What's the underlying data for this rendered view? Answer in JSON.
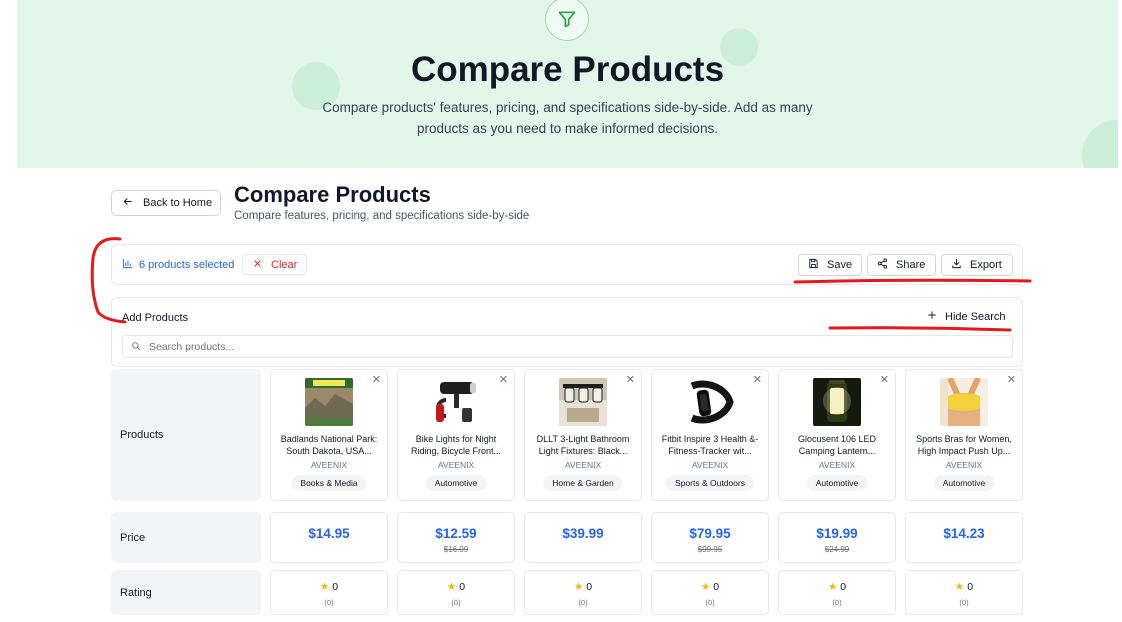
{
  "hero": {
    "title": "Compare Products",
    "subtitle": "Compare products' features, pricing, and specifications side-by-side. Add as many products as you need to make informed decisions.",
    "icon": "filter-icon"
  },
  "header": {
    "back_label": "Back to Home",
    "title": "Compare Products",
    "subtitle": "Compare features, pricing, and specifications side-by-side"
  },
  "toolbar": {
    "selected_text": "6 products selected",
    "clear_label": "Clear",
    "save_label": "Save",
    "share_label": "Share",
    "export_label": "Export"
  },
  "add_products": {
    "title": "Add Products",
    "hide_search_label": "Hide Search",
    "search_placeholder": "Search products..."
  },
  "rows": {
    "products": "Products",
    "price": "Price",
    "rating": "Rating"
  },
  "products": [
    {
      "name": "Badlands National Park: South Dakota, USA...",
      "brand": "AVEENIX",
      "category": "Books & Media",
      "price": "$14.95",
      "original_price": "",
      "rating": "0",
      "reviews": "(0)"
    },
    {
      "name": "Bike Lights for Night Riding, Bicycle Front...",
      "brand": "AVEENIX",
      "category": "Automotive",
      "price": "$12.59",
      "original_price": "$16.99",
      "rating": "0",
      "reviews": "(0)"
    },
    {
      "name": "DLLT 3-Light Bathroom Light Fixtures: Black...",
      "brand": "AVEENIX",
      "category": "Home & Garden",
      "price": "$39.99",
      "original_price": "",
      "rating": "0",
      "reviews": "(0)"
    },
    {
      "name": "Fitbit Inspire 3 Health &-Fitness-Tracker wit...",
      "brand": "AVEENIX",
      "category": "Sports & Outdoors",
      "price": "$79.95",
      "original_price": "$99.95",
      "rating": "0",
      "reviews": "(0)"
    },
    {
      "name": "Glocusent 106 LED Camping Lantern...",
      "brand": "AVEENIX",
      "category": "Automotive",
      "price": "$19.99",
      "original_price": "$24.99",
      "rating": "0",
      "reviews": "(0)"
    },
    {
      "name": "Sports Bras for Women, High Impact Push Up...",
      "brand": "AVEENIX",
      "category": "Automotive",
      "price": "$14.23",
      "original_price": "",
      "rating": "0",
      "reviews": "(0)"
    }
  ],
  "colors": {
    "accent": "#2563eb",
    "danger": "#dc2626",
    "hero_bg": "#e3f6ea",
    "star": "#f5b50a",
    "annotation": "#e01b1b"
  }
}
